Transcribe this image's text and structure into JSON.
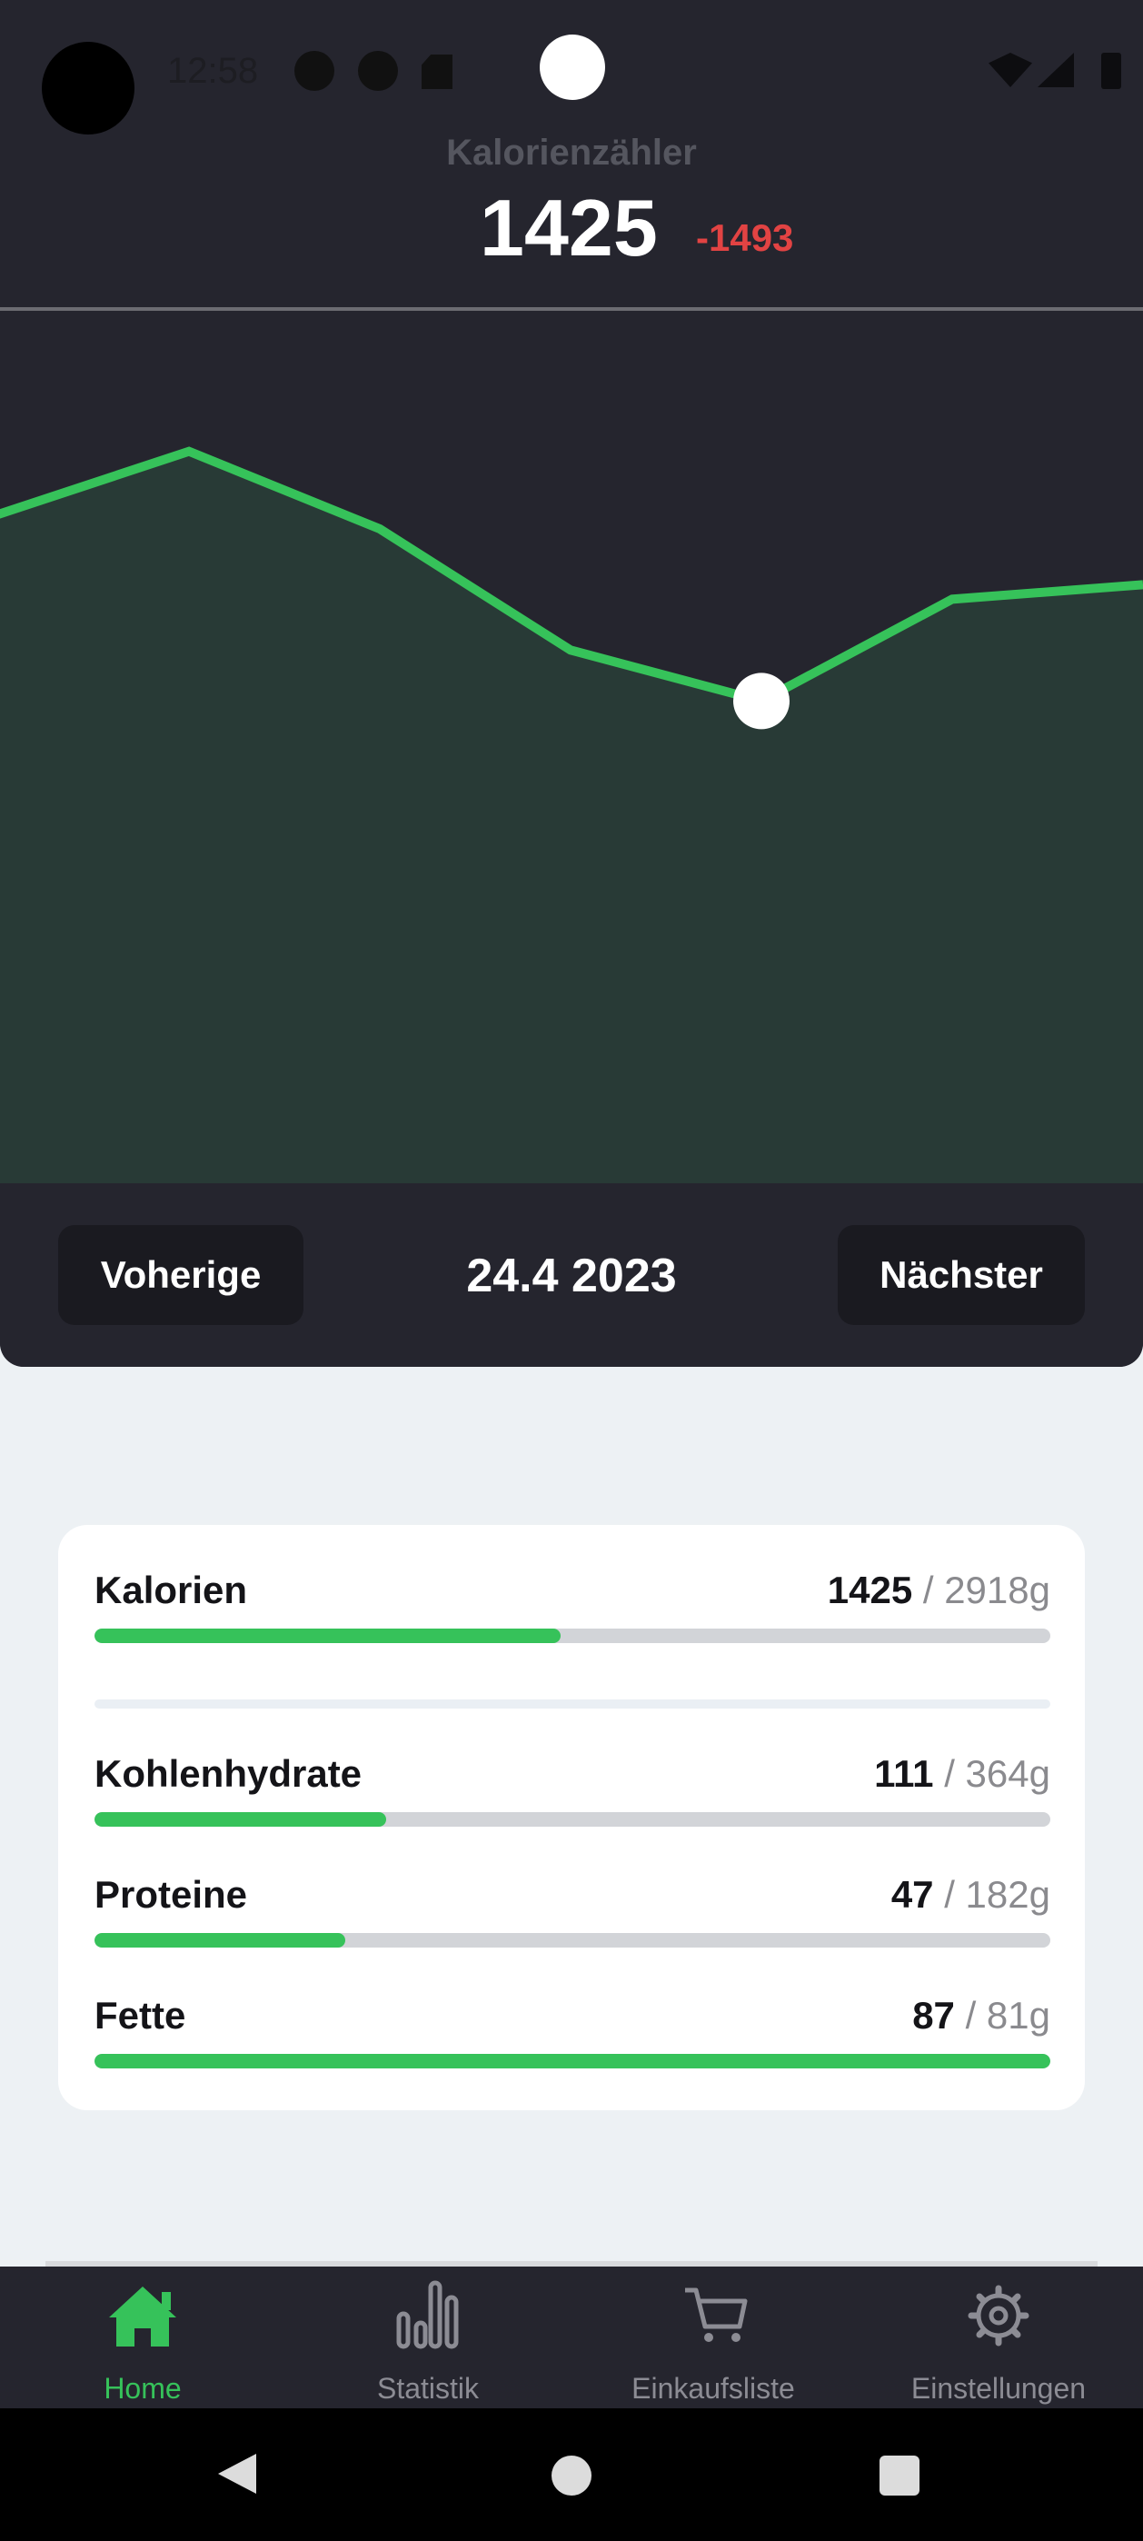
{
  "status_bar": {
    "time": "12:58"
  },
  "header": {
    "title": "Kalorienzähler",
    "calories": "1425",
    "difference": "-1493"
  },
  "chart_data": {
    "type": "area",
    "values": [
      2280,
      2410,
      2250,
      2000,
      1895,
      2105,
      2135
    ],
    "selected_index": 4,
    "ylim": [
      900,
      2700
    ],
    "grid": false,
    "line_color": "#36c25a",
    "fill_color": "#283a36"
  },
  "day_nav": {
    "prev_label": "Voherige",
    "date": "24.4 2023",
    "next_label": "Nächster"
  },
  "summary": {
    "calories": {
      "label": "Kalorien",
      "current": "1425",
      "target": " / 2918g",
      "progress": 0.488
    },
    "macros": [
      {
        "label": "Kohlenhydrate",
        "current": "111",
        "target": " / 364g",
        "progress": 0.305
      },
      {
        "label": "Proteine",
        "current": "47",
        "target": " / 182g",
        "progress": 0.262
      },
      {
        "label": "Fette",
        "current": "87",
        "target": " / 81g",
        "progress": 1.0
      }
    ]
  },
  "bottom_nav": [
    {
      "label": "Home",
      "icon": "home-icon",
      "active": true
    },
    {
      "label": "Statistik",
      "icon": "bar-chart-icon",
      "active": false
    },
    {
      "label": "Einkaufsliste",
      "icon": "cart-icon",
      "active": false
    },
    {
      "label": "Einstellungen",
      "icon": "gear-icon",
      "active": false
    }
  ],
  "colors": {
    "accent": "#36c25a",
    "danger": "#e24343",
    "dark": "#25252e"
  }
}
